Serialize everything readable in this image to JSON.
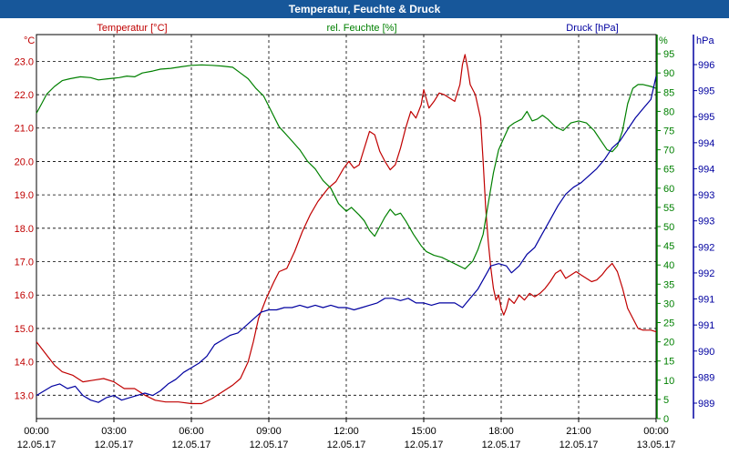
{
  "window": {
    "title": "Temperatur, Feuchte & Druck"
  },
  "chart_data": {
    "type": "line",
    "title": "Temperatur, Feuchte & Druck",
    "x_ticks": [
      {
        "time": "00:00",
        "date": "12.05.17",
        "h": 0
      },
      {
        "time": "03:00",
        "date": "12.05.17",
        "h": 3
      },
      {
        "time": "06:00",
        "date": "12.05.17",
        "h": 6
      },
      {
        "time": "09:00",
        "date": "12.05.17",
        "h": 9
      },
      {
        "time": "12:00",
        "date": "12.05.17",
        "h": 12
      },
      {
        "time": "15:00",
        "date": "12.05.17",
        "h": 15
      },
      {
        "time": "18:00",
        "date": "12.05.17",
        "h": 18
      },
      {
        "time": "21:00",
        "date": "12.05.17",
        "h": 21
      },
      {
        "time": "00:00",
        "date": "13.05.17",
        "h": 24
      }
    ],
    "xlim": [
      0,
      24
    ],
    "grid": true,
    "axes": {
      "temperature": {
        "label": "Temperatur [°C]",
        "unit": "°C",
        "color": "#c00000",
        "ylim": [
          12.3,
          23.8
        ],
        "tick_values": [
          13.0,
          14.0,
          15.0,
          16.0,
          17.0,
          18.0,
          19.0,
          20.0,
          21.0,
          22.0,
          23.0
        ],
        "tick_labels": [
          "13.0",
          "14.0",
          "15.0",
          "16.0",
          "17.0",
          "18.0",
          "19.0",
          "20.0",
          "21.0",
          "22.0",
          "23.0"
        ]
      },
      "humidity": {
        "label": "rel. Feuchte [%]",
        "unit": "%",
        "color": "#008000",
        "ylim": [
          0,
          100
        ],
        "tick_values": [
          0,
          5,
          10,
          15,
          20,
          25,
          30,
          35,
          40,
          45,
          50,
          55,
          60,
          65,
          70,
          75,
          80,
          85,
          90,
          95
        ],
        "tick_labels": [
          "0",
          "5",
          "10",
          "15",
          "20",
          "25",
          "30",
          "35",
          "40",
          "45",
          "50",
          "55",
          "60",
          "65",
          "70",
          "75",
          "80",
          "85",
          "90",
          "95"
        ]
      },
      "pressure": {
        "label": "Druck [hPa]",
        "unit": "hPa",
        "color": "#0000a0",
        "ylim": [
          988.5,
          996.8
        ],
        "tick_values": [
          989.0,
          989.7,
          990.4,
          991.1,
          991.8,
          992.5,
          993.2,
          993.9,
          994.6,
          995.3,
          996.0
        ],
        "tick_labels": [
          "989",
          "989",
          "990",
          "991",
          "991",
          "992",
          "992",
          "993",
          "993",
          "994",
          "994",
          "995",
          "995",
          "996"
        ]
      }
    },
    "series": [
      {
        "name": "Temperatur [°C]",
        "axis": "temperature",
        "color": "#c00000",
        "points": [
          [
            0,
            14.6
          ],
          [
            0.3,
            14.3
          ],
          [
            0.7,
            13.9
          ],
          [
            1.0,
            13.7
          ],
          [
            1.4,
            13.6
          ],
          [
            1.8,
            13.4
          ],
          [
            2.2,
            13.45
          ],
          [
            2.6,
            13.5
          ],
          [
            3.0,
            13.4
          ],
          [
            3.4,
            13.2
          ],
          [
            3.8,
            13.2
          ],
          [
            4.2,
            13.0
          ],
          [
            4.6,
            12.85
          ],
          [
            5.0,
            12.8
          ],
          [
            5.5,
            12.8
          ],
          [
            6.0,
            12.75
          ],
          [
            6.4,
            12.75
          ],
          [
            6.8,
            12.9
          ],
          [
            7.2,
            13.1
          ],
          [
            7.6,
            13.3
          ],
          [
            7.9,
            13.5
          ],
          [
            8.2,
            14.0
          ],
          [
            8.4,
            14.6
          ],
          [
            8.6,
            15.3
          ],
          [
            8.9,
            15.9
          ],
          [
            9.2,
            16.4
          ],
          [
            9.4,
            16.7
          ],
          [
            9.7,
            16.8
          ],
          [
            10.0,
            17.3
          ],
          [
            10.3,
            17.9
          ],
          [
            10.6,
            18.4
          ],
          [
            10.9,
            18.8
          ],
          [
            11.1,
            19.0
          ],
          [
            11.3,
            19.2
          ],
          [
            11.6,
            19.4
          ],
          [
            11.9,
            19.8
          ],
          [
            12.1,
            20.0
          ],
          [
            12.3,
            19.8
          ],
          [
            12.5,
            19.9
          ],
          [
            12.7,
            20.4
          ],
          [
            12.9,
            20.9
          ],
          [
            13.1,
            20.8
          ],
          [
            13.3,
            20.3
          ],
          [
            13.5,
            20.0
          ],
          [
            13.7,
            19.75
          ],
          [
            13.9,
            19.9
          ],
          [
            14.1,
            20.4
          ],
          [
            14.3,
            21.0
          ],
          [
            14.5,
            21.5
          ],
          [
            14.7,
            21.3
          ],
          [
            14.9,
            21.7
          ],
          [
            15.0,
            22.15
          ],
          [
            15.2,
            21.6
          ],
          [
            15.4,
            21.8
          ],
          [
            15.6,
            22.05
          ],
          [
            15.8,
            22.0
          ],
          [
            16.0,
            21.9
          ],
          [
            16.2,
            21.8
          ],
          [
            16.4,
            22.3
          ],
          [
            16.5,
            22.9
          ],
          [
            16.6,
            23.2
          ],
          [
            16.7,
            22.8
          ],
          [
            16.8,
            22.3
          ],
          [
            17.0,
            22.0
          ],
          [
            17.2,
            21.3
          ],
          [
            17.3,
            20.0
          ],
          [
            17.4,
            18.6
          ],
          [
            17.5,
            17.6
          ],
          [
            17.6,
            16.8
          ],
          [
            17.7,
            16.2
          ],
          [
            17.8,
            15.85
          ],
          [
            17.9,
            16.0
          ],
          [
            18.0,
            15.6
          ],
          [
            18.1,
            15.4
          ],
          [
            18.2,
            15.6
          ],
          [
            18.3,
            15.9
          ],
          [
            18.5,
            15.75
          ],
          [
            18.7,
            16.0
          ],
          [
            18.9,
            15.85
          ],
          [
            19.1,
            16.05
          ],
          [
            19.3,
            15.95
          ],
          [
            19.5,
            16.05
          ],
          [
            19.7,
            16.2
          ],
          [
            19.9,
            16.4
          ],
          [
            20.1,
            16.65
          ],
          [
            20.3,
            16.75
          ],
          [
            20.5,
            16.5
          ],
          [
            20.7,
            16.6
          ],
          [
            20.9,
            16.7
          ],
          [
            21.1,
            16.6
          ],
          [
            21.3,
            16.5
          ],
          [
            21.5,
            16.4
          ],
          [
            21.7,
            16.45
          ],
          [
            21.9,
            16.6
          ],
          [
            22.1,
            16.8
          ],
          [
            22.3,
            16.95
          ],
          [
            22.5,
            16.7
          ],
          [
            22.7,
            16.2
          ],
          [
            22.9,
            15.6
          ],
          [
            23.1,
            15.3
          ],
          [
            23.3,
            15.0
          ],
          [
            23.5,
            14.95
          ],
          [
            23.8,
            14.95
          ],
          [
            24.0,
            14.9
          ]
        ]
      },
      {
        "name": "rel. Feuchte [%]",
        "axis": "humidity",
        "color": "#008000",
        "points": [
          [
            0,
            79.5
          ],
          [
            0.2,
            82
          ],
          [
            0.4,
            84.5
          ],
          [
            0.7,
            86.5
          ],
          [
            1.0,
            88
          ],
          [
            1.3,
            88.5
          ],
          [
            1.7,
            89
          ],
          [
            2.1,
            88.8
          ],
          [
            2.4,
            88.2
          ],
          [
            2.8,
            88.5
          ],
          [
            3.2,
            88.8
          ],
          [
            3.5,
            89.2
          ],
          [
            3.8,
            89
          ],
          [
            4.1,
            90
          ],
          [
            4.5,
            90.5
          ],
          [
            4.8,
            91
          ],
          [
            5.2,
            91.2
          ],
          [
            5.6,
            91.6
          ],
          [
            6.0,
            92
          ],
          [
            6.4,
            92.1
          ],
          [
            6.8,
            92
          ],
          [
            7.2,
            91.8
          ],
          [
            7.6,
            91.5
          ],
          [
            7.9,
            90
          ],
          [
            8.2,
            88.5
          ],
          [
            8.5,
            86
          ],
          [
            8.8,
            84
          ],
          [
            9.1,
            80
          ],
          [
            9.4,
            76
          ],
          [
            9.8,
            73
          ],
          [
            10.2,
            70
          ],
          [
            10.5,
            67
          ],
          [
            10.8,
            65
          ],
          [
            11.1,
            62
          ],
          [
            11.4,
            60
          ],
          [
            11.7,
            56
          ],
          [
            12.0,
            54
          ],
          [
            12.2,
            55
          ],
          [
            12.5,
            53
          ],
          [
            12.7,
            51.5
          ],
          [
            12.9,
            49
          ],
          [
            13.1,
            47.5
          ],
          [
            13.3,
            50
          ],
          [
            13.5,
            52.5
          ],
          [
            13.7,
            54.5
          ],
          [
            13.9,
            53
          ],
          [
            14.1,
            53.5
          ],
          [
            14.3,
            51.5
          ],
          [
            14.6,
            48
          ],
          [
            14.9,
            45
          ],
          [
            15.1,
            43.5
          ],
          [
            15.4,
            42.5
          ],
          [
            15.7,
            42
          ],
          [
            16.0,
            41
          ],
          [
            16.3,
            40
          ],
          [
            16.6,
            39
          ],
          [
            16.9,
            41
          ],
          [
            17.1,
            44
          ],
          [
            17.3,
            48
          ],
          [
            17.5,
            56
          ],
          [
            17.7,
            64
          ],
          [
            17.9,
            70
          ],
          [
            18.1,
            73
          ],
          [
            18.3,
            76
          ],
          [
            18.5,
            77
          ],
          [
            18.8,
            78
          ],
          [
            19.0,
            80
          ],
          [
            19.2,
            77.5
          ],
          [
            19.4,
            78
          ],
          [
            19.6,
            79
          ],
          [
            19.8,
            78
          ],
          [
            20.1,
            76
          ],
          [
            20.4,
            75
          ],
          [
            20.7,
            77
          ],
          [
            21.0,
            77.5
          ],
          [
            21.3,
            77
          ],
          [
            21.6,
            75
          ],
          [
            21.9,
            72
          ],
          [
            22.1,
            70
          ],
          [
            22.3,
            69.5
          ],
          [
            22.5,
            71
          ],
          [
            22.7,
            75
          ],
          [
            22.9,
            82
          ],
          [
            23.1,
            86
          ],
          [
            23.3,
            87
          ],
          [
            23.5,
            87
          ],
          [
            23.8,
            86.5
          ],
          [
            24.0,
            86
          ]
        ]
      },
      {
        "name": "Druck [hPa]",
        "axis": "pressure",
        "color": "#0000a0",
        "points": [
          [
            0,
            989.0
          ],
          [
            0.3,
            989.1
          ],
          [
            0.6,
            989.2
          ],
          [
            0.9,
            989.25
          ],
          [
            1.2,
            989.15
          ],
          [
            1.5,
            989.2
          ],
          [
            1.8,
            989.0
          ],
          [
            2.1,
            988.9
          ],
          [
            2.4,
            988.85
          ],
          [
            2.7,
            988.95
          ],
          [
            3.0,
            989.0
          ],
          [
            3.3,
            988.9
          ],
          [
            3.6,
            988.95
          ],
          [
            3.9,
            989.0
          ],
          [
            4.2,
            989.05
          ],
          [
            4.5,
            989.0
          ],
          [
            4.8,
            989.1
          ],
          [
            5.1,
            989.25
          ],
          [
            5.4,
            989.35
          ],
          [
            5.7,
            989.5
          ],
          [
            6.0,
            989.6
          ],
          [
            6.3,
            989.7
          ],
          [
            6.6,
            989.85
          ],
          [
            6.9,
            990.1
          ],
          [
            7.2,
            990.2
          ],
          [
            7.5,
            990.3
          ],
          [
            7.8,
            990.35
          ],
          [
            8.1,
            990.5
          ],
          [
            8.4,
            990.65
          ],
          [
            8.7,
            990.8
          ],
          [
            9.0,
            990.85
          ],
          [
            9.3,
            990.85
          ],
          [
            9.6,
            990.9
          ],
          [
            9.9,
            990.9
          ],
          [
            10.2,
            990.95
          ],
          [
            10.5,
            990.9
          ],
          [
            10.8,
            990.95
          ],
          [
            11.1,
            990.9
          ],
          [
            11.4,
            990.95
          ],
          [
            11.7,
            990.9
          ],
          [
            12.0,
            990.9
          ],
          [
            12.3,
            990.85
          ],
          [
            12.6,
            990.9
          ],
          [
            12.9,
            990.95
          ],
          [
            13.2,
            991.0
          ],
          [
            13.5,
            991.1
          ],
          [
            13.8,
            991.1
          ],
          [
            14.1,
            991.05
          ],
          [
            14.4,
            991.1
          ],
          [
            14.7,
            991.0
          ],
          [
            15.0,
            991.0
          ],
          [
            15.3,
            990.95
          ],
          [
            15.6,
            991.0
          ],
          [
            15.9,
            991.0
          ],
          [
            16.2,
            991.0
          ],
          [
            16.5,
            990.9
          ],
          [
            16.8,
            991.1
          ],
          [
            17.1,
            991.3
          ],
          [
            17.4,
            991.6
          ],
          [
            17.6,
            991.8
          ],
          [
            17.9,
            991.85
          ],
          [
            18.2,
            991.8
          ],
          [
            18.4,
            991.65
          ],
          [
            18.7,
            991.8
          ],
          [
            19.0,
            992.05
          ],
          [
            19.3,
            992.2
          ],
          [
            19.6,
            992.5
          ],
          [
            19.9,
            992.8
          ],
          [
            20.2,
            993.1
          ],
          [
            20.5,
            993.35
          ],
          [
            20.8,
            993.5
          ],
          [
            21.1,
            993.6
          ],
          [
            21.4,
            993.75
          ],
          [
            21.7,
            993.9
          ],
          [
            22.0,
            994.1
          ],
          [
            22.3,
            994.35
          ],
          [
            22.6,
            994.5
          ],
          [
            22.9,
            994.75
          ],
          [
            23.2,
            995.0
          ],
          [
            23.5,
            995.2
          ],
          [
            23.8,
            995.4
          ],
          [
            24.0,
            995.9
          ]
        ]
      }
    ]
  }
}
